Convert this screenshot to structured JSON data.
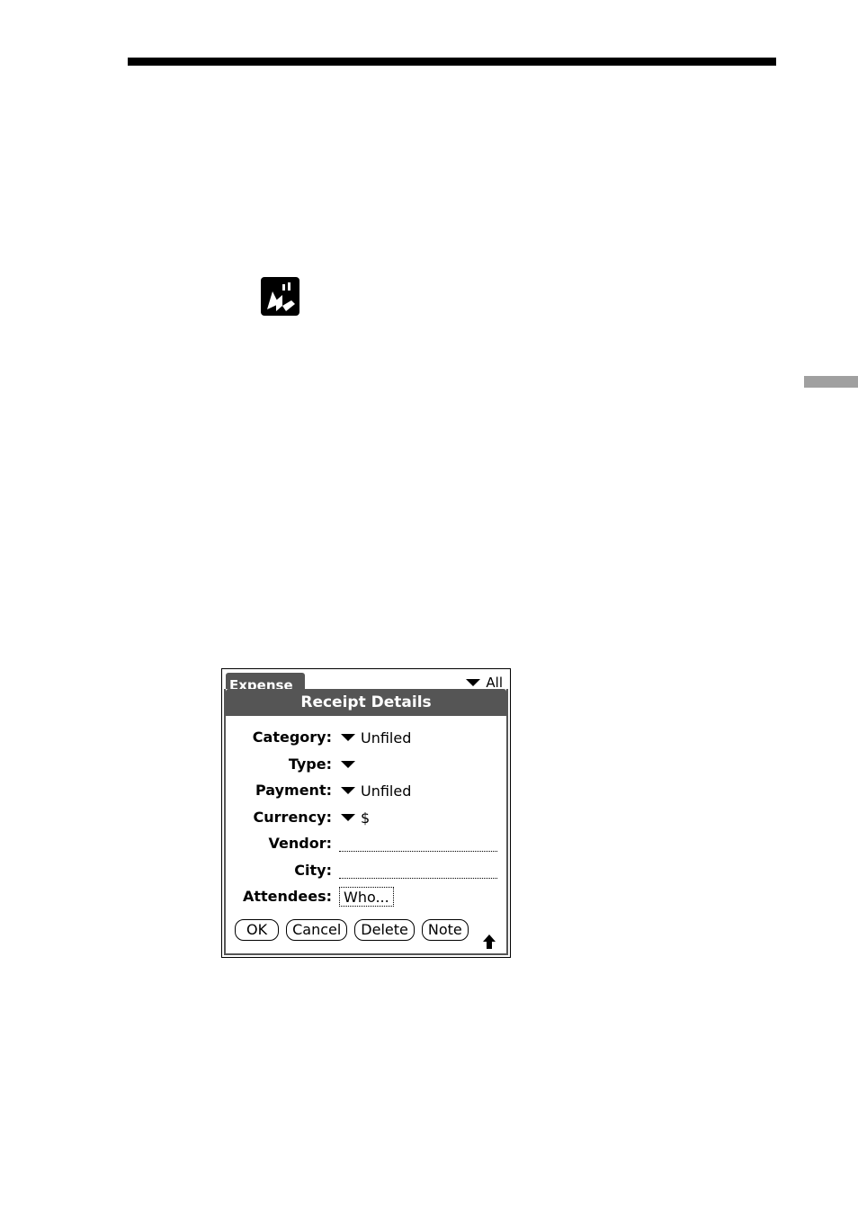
{
  "icons": {
    "app_icon": "expense-icon",
    "dropdown": "triangle-down-icon",
    "scroll": "arrow-up-icon"
  },
  "palm": {
    "app_tab": "Expense",
    "category_filter": "All",
    "dialog": {
      "title": "Receipt Details",
      "fields": {
        "category": {
          "label": "Category:",
          "value": "Unfiled"
        },
        "type": {
          "label": "Type:",
          "value": ""
        },
        "payment": {
          "label": "Payment:",
          "value": "Unfiled"
        },
        "currency": {
          "label": "Currency:",
          "value": "$"
        },
        "vendor": {
          "label": "Vendor:",
          "value": ""
        },
        "city": {
          "label": "City:",
          "value": ""
        },
        "attendees": {
          "label": "Attendees:",
          "button": "Who..."
        }
      },
      "buttons": {
        "ok": "OK",
        "cancel": "Cancel",
        "delete": "Delete",
        "note": "Note"
      }
    }
  },
  "colors": {
    "title_bar": "#555555",
    "side_tab": "#a0a0a0"
  }
}
